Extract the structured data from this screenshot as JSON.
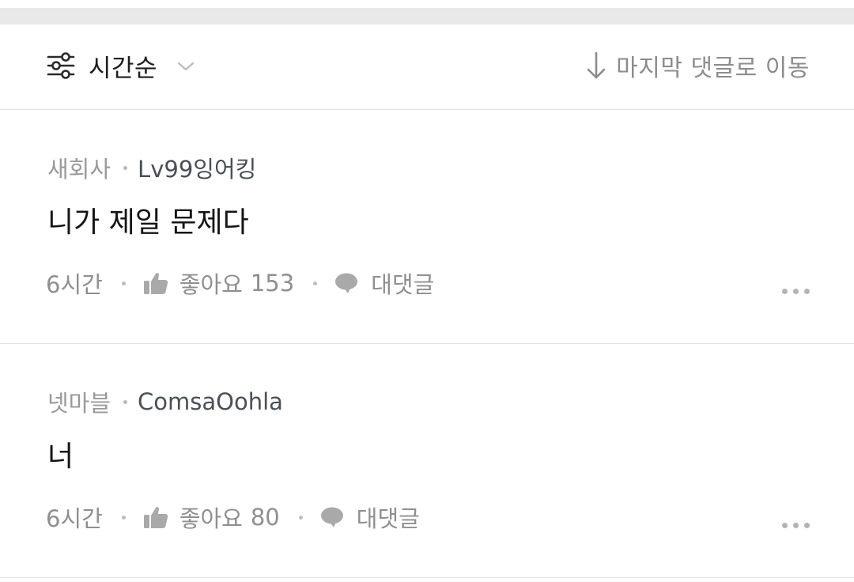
{
  "toolbar": {
    "sort_label": "시간순",
    "sort_icon": "filter-sliders-icon",
    "jump_label": "마지막 댓글로 이동",
    "jump_icon": "arrow-down-icon"
  },
  "comments": [
    {
      "company": "새회사",
      "nickname": "Lv99잉어킹",
      "text": "니가 제일 문제다",
      "time": "6시간",
      "like_label": "좋아요",
      "like_count": "153",
      "reply_label": "대댓글"
    },
    {
      "company": "넷마블",
      "nickname": "ComsaOohla",
      "text": "너",
      "time": "6시간",
      "like_label": "좋아요",
      "like_count": "80",
      "reply_label": "대댓글"
    }
  ],
  "colors": {
    "primary_text": "#151515",
    "secondary_text": "#8f8f8f",
    "nickname": "#4a4f57",
    "divider": "#e2e2e2",
    "band": "#e9e9ec"
  }
}
